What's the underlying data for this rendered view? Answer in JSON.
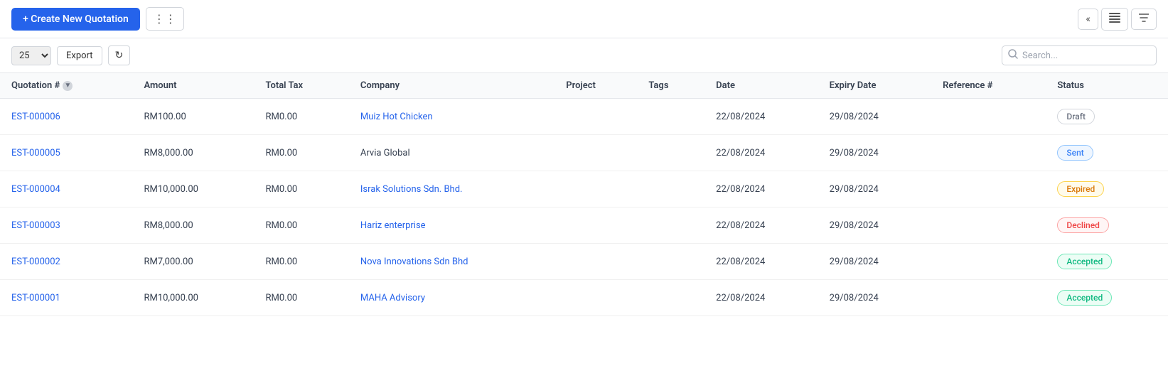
{
  "header": {
    "create_button_label": "+ Create New Quotation",
    "grid_icon": "⊞"
  },
  "top_right_buttons": {
    "collapse_icon": "«",
    "list_icon": "≡",
    "filter_icon": "▼"
  },
  "toolbar": {
    "per_page_value": "25",
    "export_label": "Export",
    "refresh_icon": "↻",
    "search_placeholder": "Search..."
  },
  "table": {
    "columns": [
      {
        "key": "quotation_num",
        "label": "Quotation #",
        "sortable": true
      },
      {
        "key": "amount",
        "label": "Amount",
        "sortable": false
      },
      {
        "key": "total_tax",
        "label": "Total Tax",
        "sortable": false
      },
      {
        "key": "company",
        "label": "Company",
        "sortable": false
      },
      {
        "key": "project",
        "label": "Project",
        "sortable": false
      },
      {
        "key": "tags",
        "label": "Tags",
        "sortable": false
      },
      {
        "key": "date",
        "label": "Date",
        "sortable": false
      },
      {
        "key": "expiry_date",
        "label": "Expiry Date",
        "sortable": false
      },
      {
        "key": "reference_num",
        "label": "Reference #",
        "sortable": false
      },
      {
        "key": "status",
        "label": "Status",
        "sortable": false
      }
    ],
    "rows": [
      {
        "quotation_num": "EST-000006",
        "amount": "RM100.00",
        "total_tax": "RM0.00",
        "company": "Muiz Hot Chicken",
        "company_link": true,
        "project": "",
        "tags": "",
        "date": "22/08/2024",
        "expiry_date": "29/08/2024",
        "reference_num": "",
        "status": "Draft",
        "status_class": "status-draft"
      },
      {
        "quotation_num": "EST-000005",
        "amount": "RM8,000.00",
        "total_tax": "RM0.00",
        "company": "Arvia Global",
        "company_link": false,
        "project": "",
        "tags": "",
        "date": "22/08/2024",
        "expiry_date": "29/08/2024",
        "reference_num": "",
        "status": "Sent",
        "status_class": "status-sent"
      },
      {
        "quotation_num": "EST-000004",
        "amount": "RM10,000.00",
        "total_tax": "RM0.00",
        "company": "Israk Solutions Sdn. Bhd.",
        "company_link": true,
        "project": "",
        "tags": "",
        "date": "22/08/2024",
        "expiry_date": "29/08/2024",
        "reference_num": "",
        "status": "Expired",
        "status_class": "status-expired"
      },
      {
        "quotation_num": "EST-000003",
        "amount": "RM8,000.00",
        "total_tax": "RM0.00",
        "company": "Hariz enterprise",
        "company_link": true,
        "project": "",
        "tags": "",
        "date": "22/08/2024",
        "expiry_date": "29/08/2024",
        "reference_num": "",
        "status": "Declined",
        "status_class": "status-declined"
      },
      {
        "quotation_num": "EST-000002",
        "amount": "RM7,000.00",
        "total_tax": "RM0.00",
        "company": "Nova Innovations Sdn Bhd",
        "company_link": true,
        "project": "",
        "tags": "",
        "date": "22/08/2024",
        "expiry_date": "29/08/2024",
        "reference_num": "",
        "status": "Accepted",
        "status_class": "status-accepted"
      },
      {
        "quotation_num": "EST-000001",
        "amount": "RM10,000.00",
        "total_tax": "RM0.00",
        "company": "MAHA Advisory",
        "company_link": true,
        "project": "",
        "tags": "",
        "date": "22/08/2024",
        "expiry_date": "29/08/2024",
        "reference_num": "",
        "status": "Accepted",
        "status_class": "status-accepted"
      }
    ]
  }
}
